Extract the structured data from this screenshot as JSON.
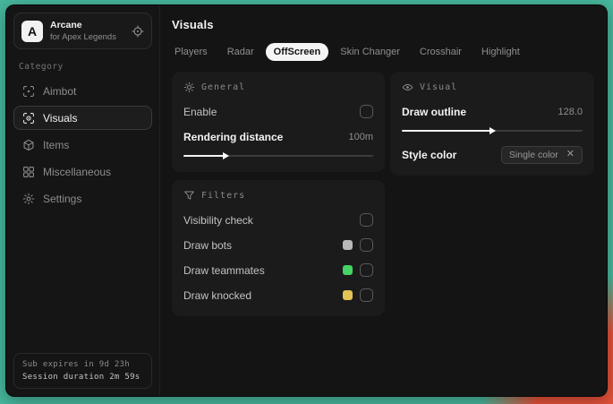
{
  "colors": {
    "desktop_teal": "#47b89d",
    "desktop_orange": "#e4523a",
    "window_bg": "#141414",
    "panel_bg": "#1b1b1c",
    "accent_white": "#f4f4f4",
    "swatch_gray": "#b8b8b8",
    "swatch_green": "#44d364",
    "swatch_yellow": "#e3c454"
  },
  "window": {
    "sidebar": {
      "logo_letter": "A",
      "app_name": "Arcane",
      "app_subtitle": "for Apex Legends",
      "category_label": "Category",
      "items": [
        {
          "label": "Aimbot",
          "icon": "crosshair-scan-icon",
          "active": false
        },
        {
          "label": "Visuals",
          "icon": "scan-eye-icon",
          "active": true
        },
        {
          "label": "Items",
          "icon": "box-icon",
          "active": false
        },
        {
          "label": "Miscellaneous",
          "icon": "grid-icon",
          "active": false
        },
        {
          "label": "Settings",
          "icon": "gear-icon",
          "active": false
        }
      ],
      "status": {
        "line1": "Sub expires in 9d 23h",
        "line2": "Session duration 2m 59s"
      }
    },
    "main": {
      "title": "Visuals",
      "tabs": [
        {
          "label": "Players",
          "active": false
        },
        {
          "label": "Radar",
          "active": false
        },
        {
          "label": "OffScreen",
          "active": true
        },
        {
          "label": "Skin Changer",
          "active": false
        },
        {
          "label": "Crosshair",
          "active": false
        },
        {
          "label": "Highlight",
          "active": false
        }
      ],
      "panels": {
        "general": {
          "title": "General",
          "enable_label": "Enable",
          "enable_checked": false,
          "rendering_distance_label": "Rendering distance",
          "rendering_distance_value": "100m",
          "rendering_distance_percent": 22
        },
        "filters": {
          "title": "Filters",
          "rows": [
            {
              "label": "Visibility check",
              "swatch": null,
              "checked": false
            },
            {
              "label": "Draw bots",
              "swatch": "#b8b8b8",
              "checked": false
            },
            {
              "label": "Draw teammates",
              "swatch": "#44d364",
              "checked": false
            },
            {
              "label": "Draw knocked",
              "swatch": "#e3c454",
              "checked": false
            }
          ]
        },
        "visual": {
          "title": "Visual",
          "draw_outline_label": "Draw outline",
          "draw_outline_value": "128.0",
          "draw_outline_percent": 50,
          "style_color_label": "Style color",
          "style_color_value": "Single color"
        }
      }
    }
  }
}
